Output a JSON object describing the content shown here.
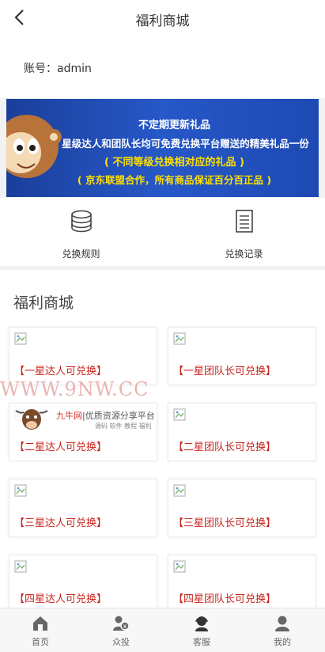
{
  "header": {
    "title": "福利商城"
  },
  "account": {
    "label": "账号：",
    "value": "admin"
  },
  "banner": {
    "line1": "不定期更新礼品",
    "line2": "星级达人和团队长均可免费兑换平台赠送的精美礼品一份",
    "line3": "( 不同等级兑换相对应的礼品 )",
    "line4": "( 京东联盟合作，所有商品保证百分百正品 )"
  },
  "actions": [
    {
      "label": "兑换规则",
      "icon": "coin-stack-icon"
    },
    {
      "label": "兑换记录",
      "icon": "document-icon"
    }
  ],
  "mall": {
    "title": "福利商城",
    "items": [
      "【一星达人可兑换】",
      "【一星团队长可兑换】",
      "【二星达人可兑换】",
      "【二星团队长可兑换】",
      "【三星达人可兑换】",
      "【三星团队长可兑换】",
      "【四星达人可兑换】",
      "【四星团队长可兑换】"
    ]
  },
  "watermark": {
    "site": "WWW.9NW.CC",
    "brand": "九牛网",
    "slogan": "|优质资源分享平台",
    "tags": "源码 软件 教程 福利"
  },
  "tabbar": [
    {
      "label": "首页",
      "icon": "home-icon"
    },
    {
      "label": "众投",
      "icon": "people-icon"
    },
    {
      "label": "客服",
      "icon": "service-icon"
    },
    {
      "label": "我的",
      "icon": "user-icon"
    }
  ]
}
